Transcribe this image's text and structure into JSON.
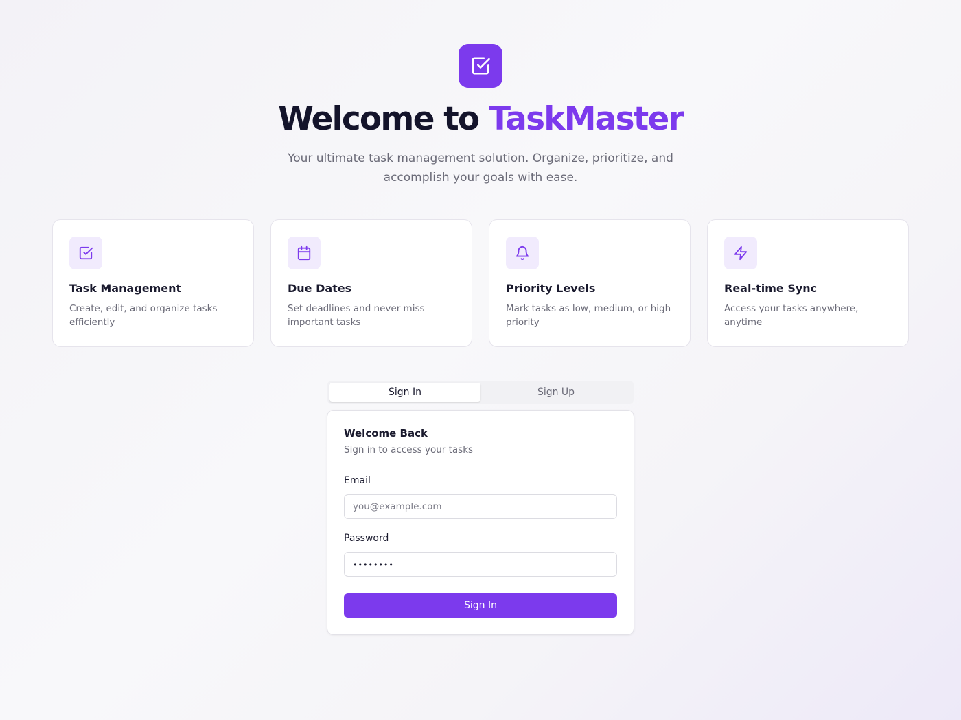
{
  "header": {
    "logo_icon": "check-square-icon",
    "title_prefix": "Welcome to ",
    "title_brand": "TaskMaster",
    "subtitle": "Your ultimate task management solution. Organize, prioritize, and accomplish your goals with ease."
  },
  "features": [
    {
      "icon": "check-square-icon",
      "title": "Task Management",
      "description": "Create, edit, and organize tasks efficiently"
    },
    {
      "icon": "calendar-icon",
      "title": "Due Dates",
      "description": "Set deadlines and never miss important tasks"
    },
    {
      "icon": "bell-icon",
      "title": "Priority Levels",
      "description": "Mark tasks as low, medium, or high priority"
    },
    {
      "icon": "lightning-icon",
      "title": "Real-time Sync",
      "description": "Access your tasks anywhere, anytime"
    }
  ],
  "auth": {
    "tabs": [
      {
        "label": "Sign In",
        "active": true
      },
      {
        "label": "Sign Up",
        "active": false
      }
    ],
    "form": {
      "title": "Welcome Back",
      "subtitle": "Sign in to access your tasks",
      "email_label": "Email",
      "email_placeholder": "you@example.com",
      "email_value": "",
      "password_label": "Password",
      "password_value": "••••••••",
      "submit_label": "Sign In"
    }
  },
  "colors": {
    "accent": "#7c3aed",
    "icon_bg": "#f1ebfd"
  }
}
